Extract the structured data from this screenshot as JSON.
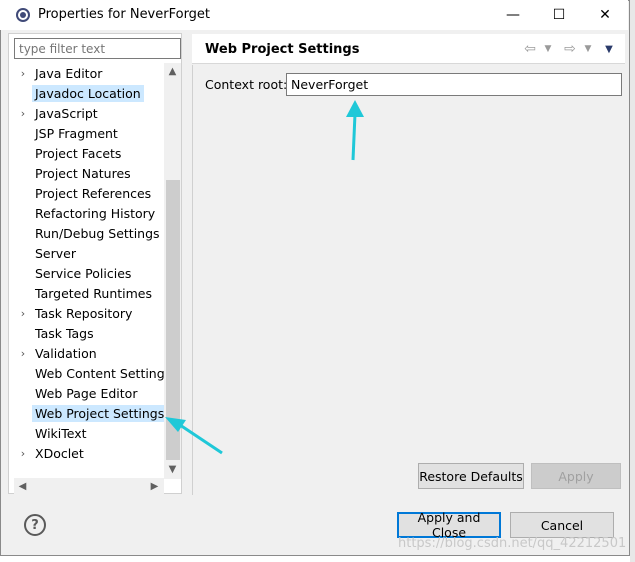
{
  "window": {
    "title": "Properties for NeverForget",
    "minimize_glyph": "—",
    "maximize_glyph": "☐",
    "close_glyph": "✕"
  },
  "filter": {
    "placeholder": "type filter text"
  },
  "tree": {
    "items": [
      {
        "label": "Java Editor",
        "expandable": true,
        "selected": false
      },
      {
        "label": "Javadoc Location",
        "expandable": false,
        "selected": false,
        "highlight": true
      },
      {
        "label": "JavaScript",
        "expandable": true,
        "selected": false
      },
      {
        "label": "JSP Fragment",
        "expandable": false,
        "selected": false
      },
      {
        "label": "Project Facets",
        "expandable": false,
        "selected": false
      },
      {
        "label": "Project Natures",
        "expandable": false,
        "selected": false
      },
      {
        "label": "Project References",
        "expandable": false,
        "selected": false
      },
      {
        "label": "Refactoring History",
        "expandable": false,
        "selected": false
      },
      {
        "label": "Run/Debug Settings",
        "expandable": false,
        "selected": false
      },
      {
        "label": "Server",
        "expandable": false,
        "selected": false
      },
      {
        "label": "Service Policies",
        "expandable": false,
        "selected": false
      },
      {
        "label": "Targeted Runtimes",
        "expandable": false,
        "selected": false
      },
      {
        "label": "Task Repository",
        "expandable": true,
        "selected": false
      },
      {
        "label": "Task Tags",
        "expandable": false,
        "selected": false
      },
      {
        "label": "Validation",
        "expandable": true,
        "selected": false
      },
      {
        "label": "Web Content Settings",
        "expandable": false,
        "selected": false
      },
      {
        "label": "Web Page Editor",
        "expandable": false,
        "selected": false
      },
      {
        "label": "Web Project Settings",
        "expandable": false,
        "selected": true
      },
      {
        "label": "WikiText",
        "expandable": false,
        "selected": false
      },
      {
        "label": "XDoclet",
        "expandable": true,
        "selected": false
      }
    ]
  },
  "page": {
    "title": "Web Project Settings",
    "context_root_label": "Context root:",
    "context_root_value": "NeverForget"
  },
  "buttons": {
    "restore_defaults": "Restore Defaults",
    "apply": "Apply",
    "apply_and_close": "Apply and Close",
    "cancel": "Cancel",
    "help": "?"
  },
  "watermark": "https://blog.csdn.net/qq_42212501",
  "colors": {
    "selection": "#cce8ff",
    "annotation_arrow": "#1fc8d8",
    "default_button_border": "#0078d7"
  }
}
